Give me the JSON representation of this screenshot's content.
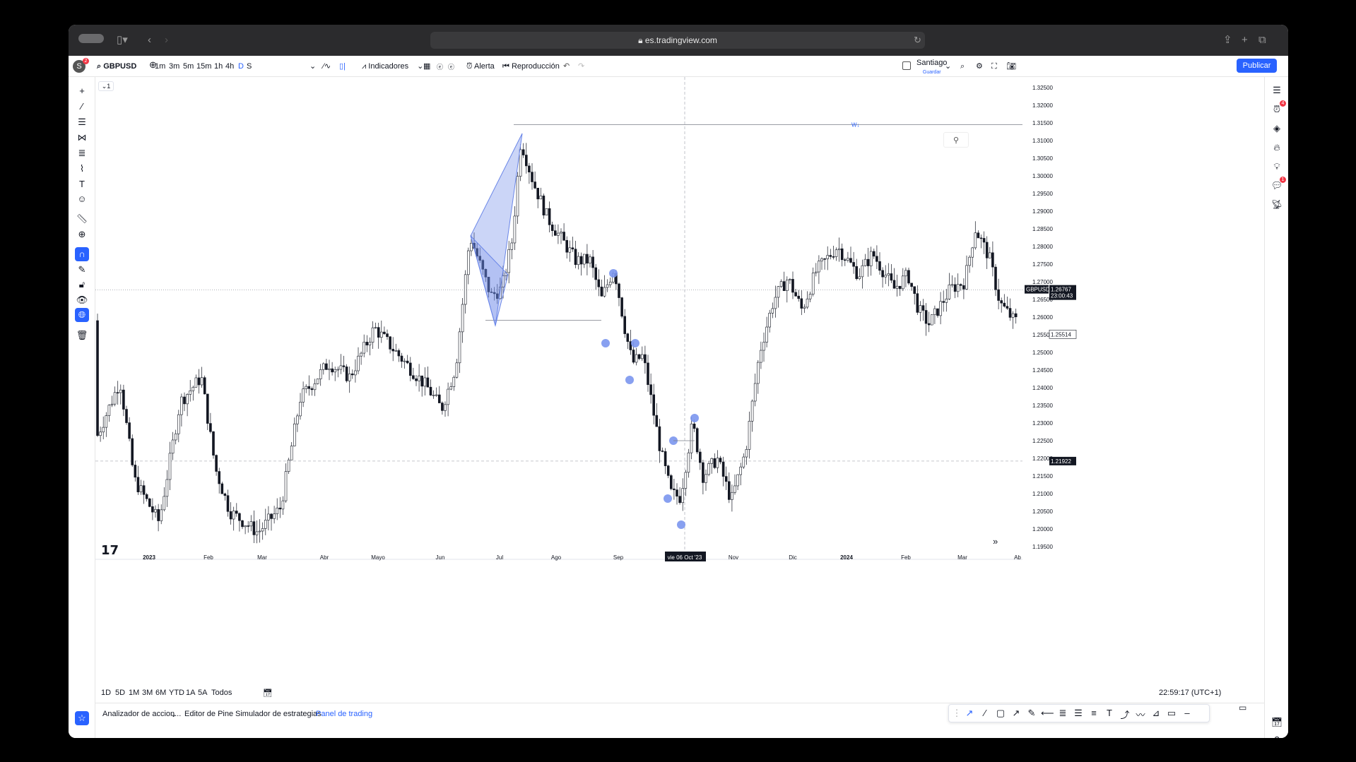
{
  "browser": {
    "url": "es.tradingview.com"
  },
  "toolbar": {
    "avatar_letter": "S",
    "avatar_badge": "2",
    "symbol": "GBPUSD",
    "intervals": [
      "1m",
      "3m",
      "5m",
      "15m",
      "1h",
      "4h",
      "D",
      "S"
    ],
    "active_interval": "D",
    "indicators_label": "Indicadores",
    "alert_label": "Alerta",
    "replay_label": "Reproducción",
    "layout_name": "Santiago",
    "layout_status": "Guardar",
    "publish_label": "Publicar"
  },
  "left_tools": [
    "crosshair-icon",
    "trend-line-icon",
    "fib-icon",
    "pattern-icon",
    "measure-lines-icon",
    "brush-icon",
    "text-icon",
    "emoji-icon",
    "ruler-icon",
    "zoom-in-icon",
    "magnet-icon",
    "pencil-lock-icon",
    "lock-icon",
    "eye-icon",
    "globe-icon",
    "trash-icon"
  ],
  "right_tools": [
    {
      "name": "watchlist-icon"
    },
    {
      "name": "alerts-icon",
      "badge": "4"
    },
    {
      "name": "layers-icon"
    },
    {
      "name": "hotlist-icon"
    },
    {
      "name": "ideas-icon"
    },
    {
      "name": "chat-icon",
      "badge": "1"
    },
    {
      "name": "broadcast-icon"
    }
  ],
  "legend": {
    "collapse_label": "1"
  },
  "chart_data": {
    "type": "candlestick",
    "symbol": "GBPUSD",
    "y_ticks": [
      "1.32500",
      "1.32000",
      "1.31500",
      "1.31000",
      "1.30500",
      "1.30000",
      "1.29500",
      "1.29000",
      "1.28500",
      "1.28000",
      "1.27500",
      "1.27000",
      "1.26500",
      "1.26000",
      "1.25500",
      "1.25000",
      "1.24500",
      "1.24000",
      "1.23500",
      "1.23000",
      "1.22500",
      "1.22000",
      "1.21500",
      "1.21000",
      "1.20500",
      "1.20000",
      "1.19500"
    ],
    "ylim": [
      1.195,
      1.325
    ],
    "x_ticks": [
      "2023",
      "Feb",
      "Mar",
      "Abr",
      "Mayo",
      "Jun",
      "Jul",
      "Ago",
      "Sep",
      "vie 06 Oct '23",
      "Nov",
      "Dic",
      "2024",
      "Feb",
      "Mar",
      "Ab"
    ],
    "price_label_symbol": "GBPUSD",
    "current_price": "1.26767",
    "countdown": "23:00:43",
    "low_price_label": "1.25514",
    "crosshair_price": "1.21922",
    "resistance_label": "W↓",
    "current_value": 1.26767,
    "crosshair_value": 1.21922,
    "resistance_value": 1.3145,
    "neckline_value": 1.2591
  },
  "ranges": [
    "1D",
    "5D",
    "1M",
    "3M",
    "6M",
    "YTD",
    "1A",
    "5A",
    "Todos"
  ],
  "clock": "22:59:17 (UTC+1)",
  "bottom_tabs": [
    "Analizador de accion...",
    "Editor de Pine",
    "Simulador de estrategias",
    "Panel de trading"
  ],
  "active_tab": "Panel de trading",
  "colors": {
    "accent": "#2962ff",
    "pattern_fill": "#6a86e8",
    "point_marker": "#7b96ee",
    "candle": "#131722"
  }
}
